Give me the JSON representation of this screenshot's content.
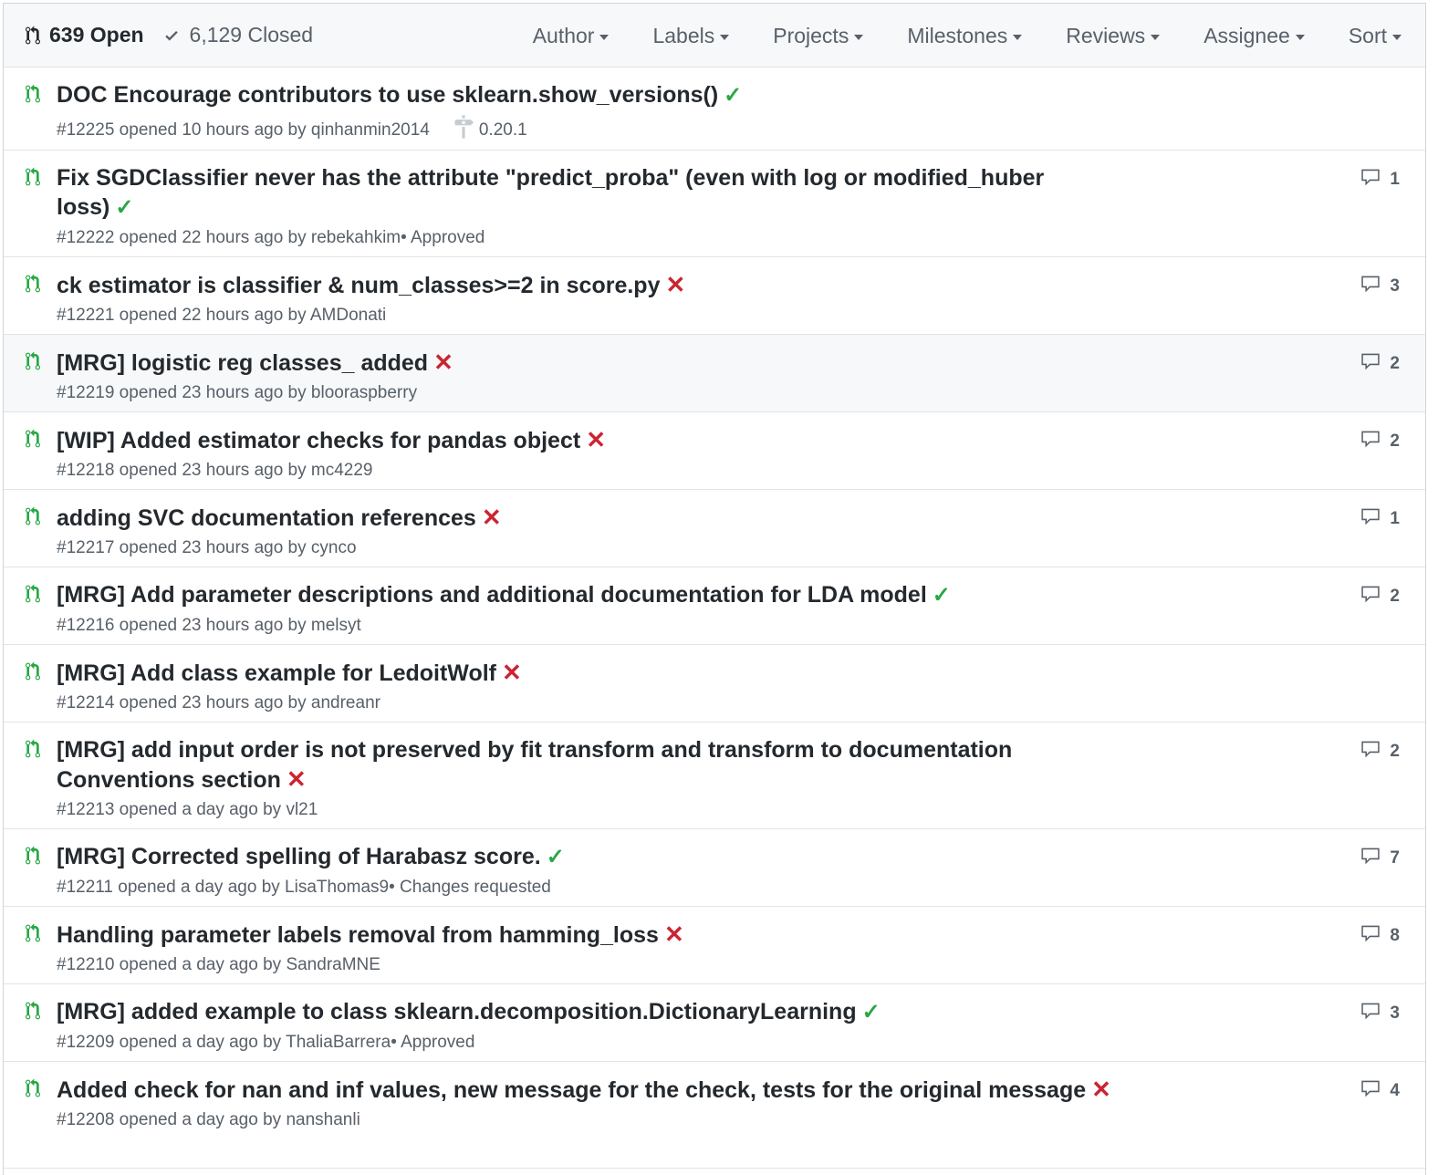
{
  "header": {
    "open_label": "639 Open",
    "closed_label": "6,129 Closed",
    "filters": [
      "Author",
      "Labels",
      "Projects",
      "Milestones",
      "Reviews",
      "Assignee",
      "Sort"
    ]
  },
  "colors": {
    "green": "#28a745",
    "red": "#cb2431",
    "muted": "#586069"
  },
  "pulls": [
    {
      "title": "DOC Encourage contributors to use sklearn.show_versions()",
      "status": "success",
      "meta": "#12225 opened 10 hours ago by qinhanmin2014",
      "review": "",
      "milestone": "0.20.1",
      "comments": ""
    },
    {
      "title": "Fix SGDClassifier never has the attribute \"predict_proba\" (even with log or modified_huber loss)",
      "status": "success",
      "meta": "#12222 opened 22 hours ago by rebekahkim",
      "review": " • Approved",
      "milestone": "",
      "comments": "1"
    },
    {
      "title": "ck estimator is classifier & num_classes>=2 in score.py",
      "status": "failure",
      "meta": "#12221 opened 22 hours ago by AMDonati",
      "review": "",
      "milestone": "",
      "comments": "3"
    },
    {
      "title": "[MRG] logistic reg classes_ added",
      "status": "failure",
      "meta": "#12219 opened 23 hours ago by blooraspberry",
      "review": "",
      "milestone": "",
      "comments": "2"
    },
    {
      "title": "[WIP] Added estimator checks for pandas object",
      "status": "failure",
      "meta": "#12218 opened 23 hours ago by mc4229",
      "review": "",
      "milestone": "",
      "comments": "2"
    },
    {
      "title": "adding SVC documentation references",
      "status": "failure",
      "meta": "#12217 opened 23 hours ago by cynco",
      "review": "",
      "milestone": "",
      "comments": "1"
    },
    {
      "title": "[MRG] Add parameter descriptions and additional documentation for LDA model",
      "status": "success",
      "meta": "#12216 opened 23 hours ago by melsyt",
      "review": "",
      "milestone": "",
      "comments": "2"
    },
    {
      "title": "[MRG] Add class example for LedoitWolf",
      "status": "failure",
      "meta": "#12214 opened 23 hours ago by andreanr",
      "review": "",
      "milestone": "",
      "comments": ""
    },
    {
      "title": "[MRG] add input order is not preserved by fit transform and transform to documentation Conventions section",
      "status": "failure",
      "meta": "#12213 opened a day ago by vl21",
      "review": "",
      "milestone": "",
      "comments": "2"
    },
    {
      "title": "[MRG] Corrected spelling of Harabasz score.",
      "status": "success",
      "meta": "#12211 opened a day ago by LisaThomas9",
      "review": " • Changes requested",
      "milestone": "",
      "comments": "7"
    },
    {
      "title": "Handling parameter labels removal from hamming_loss",
      "status": "failure",
      "meta": "#12210 opened a day ago by SandraMNE",
      "review": "",
      "milestone": "",
      "comments": "8"
    },
    {
      "title": "[MRG] added example to class sklearn.decomposition.DictionaryLearning",
      "status": "success",
      "meta": "#12209 opened a day ago by ThaliaBarrera",
      "review": " • Approved",
      "milestone": "",
      "comments": "3"
    },
    {
      "title": "Added check for nan and inf values, new message for the check, tests for the original message",
      "status": "failure",
      "meta": "#12208 opened a day ago by nanshanli",
      "review": "",
      "milestone": "",
      "comments": "4"
    }
  ]
}
